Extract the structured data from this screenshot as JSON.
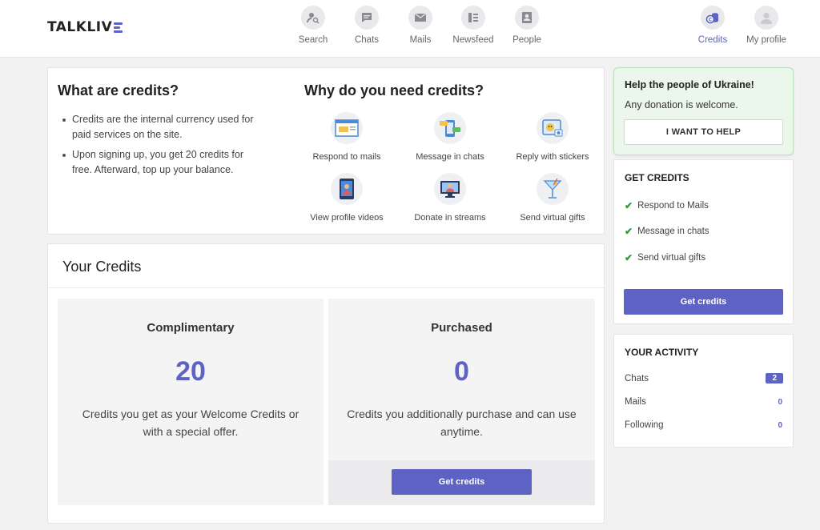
{
  "brand": {
    "logo_text": "TALKLIV",
    "accent_color": "#5c63c4"
  },
  "nav": {
    "items": [
      {
        "label": "Search",
        "icon": "search-user-icon"
      },
      {
        "label": "Chats",
        "icon": "chat-bubble-icon"
      },
      {
        "label": "Mails",
        "icon": "envelope-icon"
      },
      {
        "label": "Newsfeed",
        "icon": "newsfeed-icon"
      },
      {
        "label": "People",
        "icon": "person-card-icon"
      }
    ],
    "right": [
      {
        "label": "Credits",
        "icon": "coins-icon",
        "active": true
      },
      {
        "label": "My profile",
        "icon": "avatar-icon"
      }
    ]
  },
  "what": {
    "title": "What are credits?",
    "bullets": [
      "Credits are the internal currency used for paid services on the site.",
      "Upon signing up, you get 20 credits for free. Afterward, top up your balance."
    ]
  },
  "why": {
    "title": "Why do you need credits?",
    "features": [
      {
        "label": "Respond to mails",
        "icon": "mail-window-icon"
      },
      {
        "label": "Message in chats",
        "icon": "chat-phone-icon"
      },
      {
        "label": "Reply with stickers",
        "icon": "sticker-icon"
      },
      {
        "label": "View profile videos",
        "icon": "video-tablet-icon"
      },
      {
        "label": "Donate in streams",
        "icon": "stream-monitor-icon"
      },
      {
        "label": "Send virtual gifts",
        "icon": "cocktail-icon"
      }
    ]
  },
  "your_credits": {
    "title": "Your Credits",
    "complimentary": {
      "title": "Complimentary",
      "value": "20",
      "desc": "Credits you get as your Welcome Credits or with a special offer."
    },
    "purchased": {
      "title": "Purchased",
      "value": "0",
      "desc": "Credits you additionally purchase and can use anytime.",
      "button": "Get credits"
    }
  },
  "ukraine": {
    "title": "Help the people of Ukraine!",
    "subtitle": "Any donation is welcome.",
    "button": "I WANT TO HELP"
  },
  "get_credits": {
    "title": "GET CREDITS",
    "items": [
      "Respond to Mails",
      "Message in chats",
      "Send virtual gifts"
    ],
    "button": "Get credits"
  },
  "activity": {
    "title": "YOUR ACTIVITY",
    "rows": [
      {
        "label": "Chats",
        "value": "2"
      },
      {
        "label": "Mails",
        "value": "0"
      },
      {
        "label": "Following",
        "value": "0"
      }
    ]
  }
}
